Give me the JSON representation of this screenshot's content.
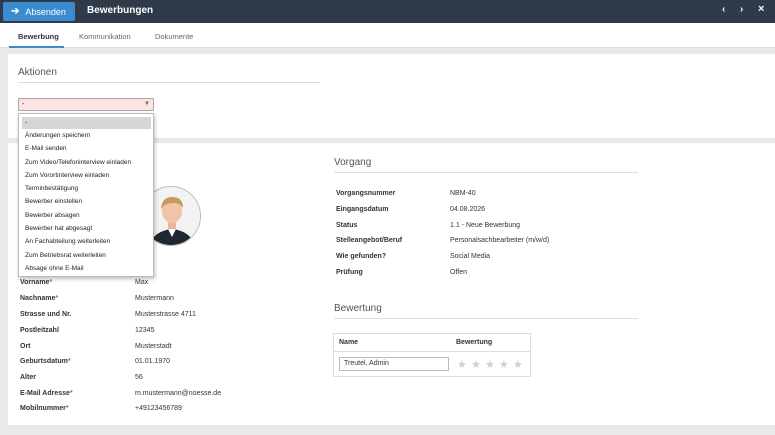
{
  "toolbar": {
    "send_label": "Absenden",
    "title": "Bewerbungen",
    "nav_prev": "‹",
    "nav_next": "›",
    "nav_close": "×"
  },
  "tabs": [
    "Bewerbung",
    "Kommunikation",
    "Dokumente"
  ],
  "actions": {
    "title": "Aktionen",
    "select_value": "-",
    "options": [
      "-",
      "Änderungen speichern",
      "E-Mail senden",
      "Zum Video/Telefoninterview einladen",
      "Zum Vorortinterview einladen",
      "Terminbestätigung",
      "Bewerber einstellen",
      "Bewerber absagen",
      "Bewerber hat abgesagt",
      "An Fachabteilung weiterleiten",
      "Zum Betriebsrat weiterleiten",
      "Absage ohne E-Mail"
    ]
  },
  "applicant": {
    "fields": [
      {
        "label": "Vorname",
        "required": "*",
        "value": "Max"
      },
      {
        "label": "Nachname",
        "required": "*",
        "value": "Mustermann"
      },
      {
        "label": "Strasse und Nr.",
        "required": "",
        "value": "Musterstrasse 4711"
      },
      {
        "label": "Postleitzahl",
        "required": "",
        "value": "12345"
      },
      {
        "label": "Ort",
        "required": "",
        "value": "Musterstadt"
      },
      {
        "label": "Geburtsdatum",
        "required": "*",
        "value": "01.01.1970"
      },
      {
        "label": "Alter",
        "required": "",
        "value": "56"
      },
      {
        "label": "E-Mail Adresse",
        "required": "*",
        "value": "m.mustermann@noesse.de"
      },
      {
        "label": "Mobilnummer",
        "required": "*",
        "value": "+49123456789"
      }
    ]
  },
  "process": {
    "title": "Vorgang",
    "fields": [
      {
        "label": "Vorgangsnummer",
        "value": "NBM-40"
      },
      {
        "label": "Eingangsdatum",
        "value": "04.08.2026"
      },
      {
        "label": "Status",
        "value": "1.1 - Neue Bewerbung"
      },
      {
        "label": "Stelleangebot/Beruf",
        "value": "Personalsachbearbeiter (m/w/d)"
      },
      {
        "label": "Wie gefunden?",
        "value": "Social Media"
      },
      {
        "label": "Prüfung",
        "value": "Offen"
      }
    ]
  },
  "rating": {
    "title": "Bewertung",
    "col_name": "Name",
    "col_rating": "Bewertung",
    "row_name": "Treutel, Admin",
    "stars": "★",
    "star_count": 5,
    "rating_value": 0
  },
  "colors": {
    "topbar": "#2f3a4a",
    "accent": "#3b8bd0",
    "required": "#d9534f"
  }
}
